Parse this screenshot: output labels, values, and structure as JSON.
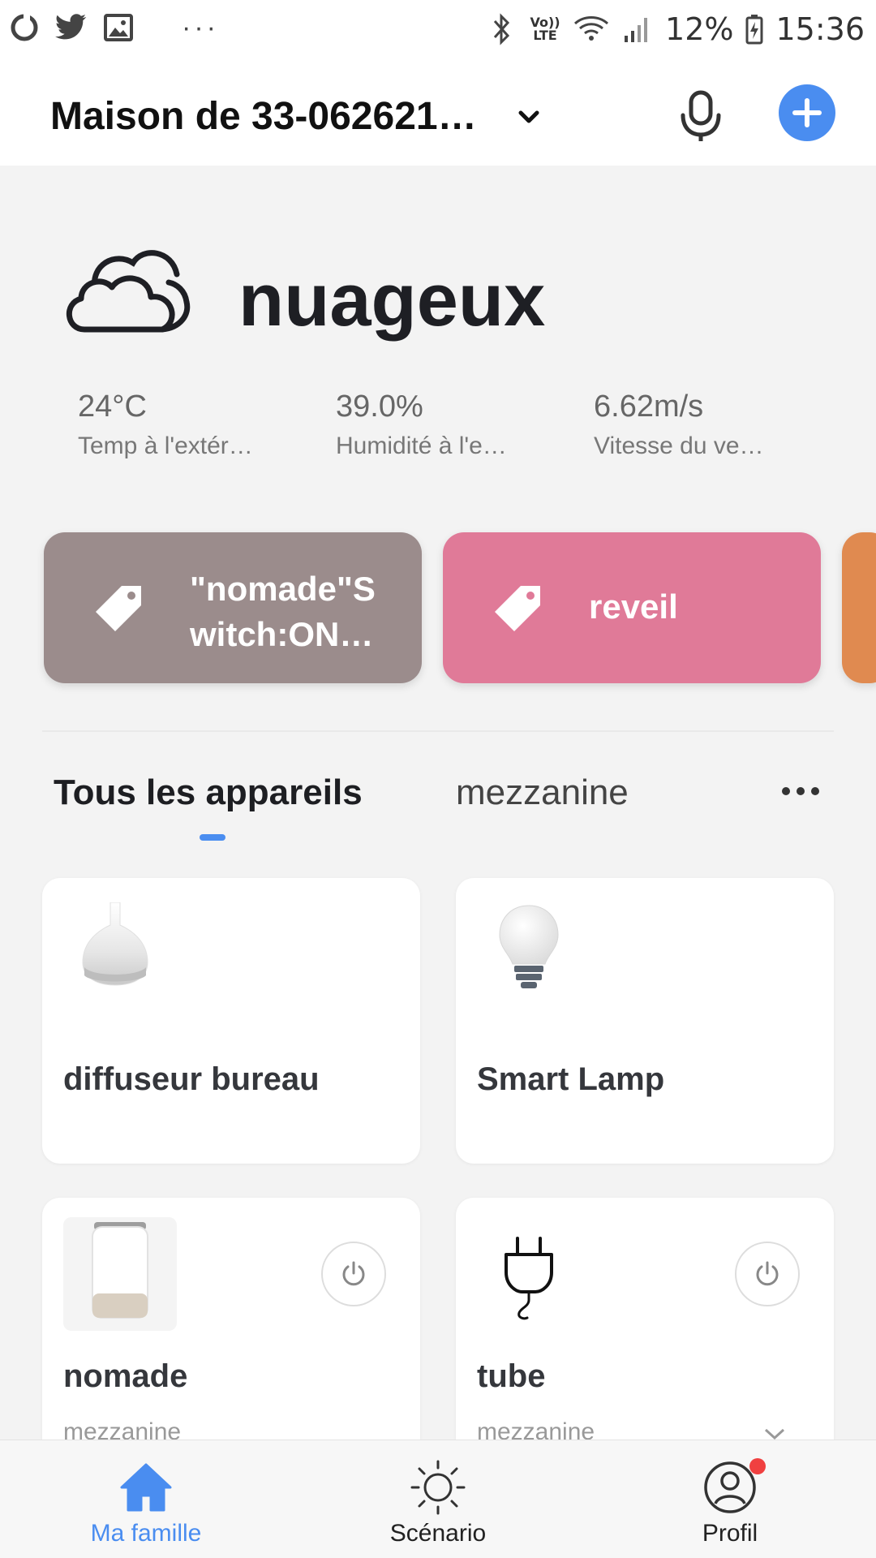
{
  "status_bar": {
    "battery": "12%",
    "time": "15:36",
    "volte_top": "Vo))",
    "volte_bottom": "LTE",
    "dots": "···"
  },
  "header": {
    "home_name": "Maison de 33-062621…"
  },
  "weather": {
    "condition": "nuageux",
    "stats": [
      {
        "value": "24°C",
        "label": "Temp à l'extér…"
      },
      {
        "value": "39.0%",
        "label": "Humidité à l'e…"
      },
      {
        "value": "6.62m/s",
        "label": "Vitesse du ve…"
      }
    ]
  },
  "scenes": [
    {
      "label_line1": "\"nomade\"S",
      "label_line2": "witch:ON…",
      "color": "#9b8c8c"
    },
    {
      "label": "reveil",
      "color": "#e07a98"
    },
    {
      "color": "#e08a50"
    }
  ],
  "tabs": {
    "active": "Tous les appareils",
    "second": "mezzanine"
  },
  "devices": [
    {
      "name": "diffuseur bureau"
    },
    {
      "name": "Smart Lamp"
    },
    {
      "name": "nomade",
      "room": "mezzanine"
    },
    {
      "name": "tube",
      "room": "mezzanine"
    }
  ],
  "bottom_nav": [
    {
      "label": "Ma famille",
      "icon": "home-icon",
      "active": true
    },
    {
      "label": "Scénario",
      "icon": "sun-icon"
    },
    {
      "label": "Profil",
      "icon": "profile-icon"
    }
  ],
  "colors": {
    "accent": "#4a8df0",
    "badge": "#f04040"
  }
}
